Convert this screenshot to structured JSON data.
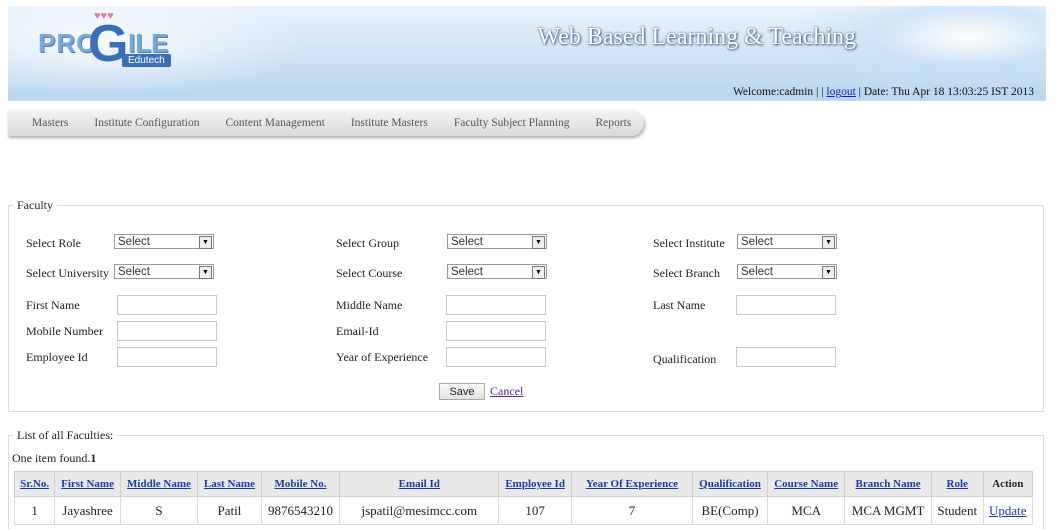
{
  "header": {
    "logo_pro": "PRO",
    "logo_g": "G",
    "logo_ile": "ILE",
    "logo_sub": "Edutech",
    "app_title": "Web Based Learning & Teaching",
    "welcome_text": "Welcome:cadmin | |",
    "logout_label": "logout",
    "date_text": "| Date: Thu Apr 18 13:03:25 IST 2013"
  },
  "menu": [
    "Masters",
    "Institute Configuration",
    "Content Management",
    "Institute Masters",
    "Faculty Subject Planning",
    "Reports"
  ],
  "faculty_form": {
    "legend": "Faculty",
    "select_role_label": "Select Role",
    "select_role_value": "Select",
    "select_group_label": "Select Group",
    "select_group_value": "Select",
    "select_institute_label": "Select Institute",
    "select_institute_value": "Select",
    "select_university_label": "Select University",
    "select_university_value": "Select",
    "select_course_label": "Select Course",
    "select_course_value": "Select",
    "select_branch_label": "Select Branch",
    "select_branch_value": "Select",
    "first_name_label": "First Name",
    "middle_name_label": "Middle Name",
    "last_name_label": "Last Name",
    "mobile_label": "Mobile Number",
    "email_label": "Email-Id",
    "employee_id_label": "Employee Id",
    "experience_label": "Year of Experience",
    "qualification_label": "Qualification",
    "save_label": "Save",
    "cancel_label": "Cancel"
  },
  "list": {
    "legend": "List of all Faculties:",
    "found_text": "One item found.",
    "found_page": "1",
    "columns": [
      "Sr.No.",
      "First Name",
      "Middle Name",
      "Last Name",
      "Mobile No.",
      "Email Id",
      "Employee Id",
      "Year Of Experience",
      "Qualification",
      "Course Name",
      "Branch Name",
      "Role",
      "Action"
    ],
    "rows": [
      [
        "1",
        "Jayashree",
        "S",
        "Patil",
        "9876543210",
        "jspatil@mesimcc.com",
        "107",
        "7",
        "BE(Comp)",
        "MCA",
        "MCA MGMT",
        "Student",
        "Update"
      ]
    ]
  }
}
